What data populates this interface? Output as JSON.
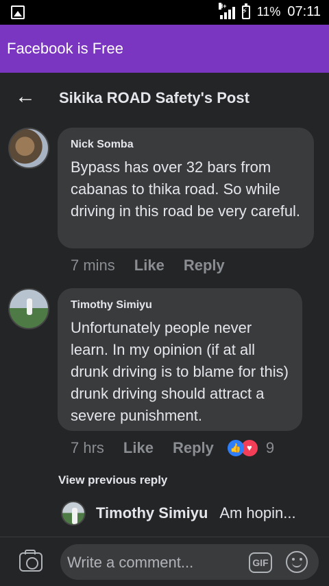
{
  "status_bar": {
    "network_label": "H+",
    "battery_percent": "11%",
    "time": "07:11",
    "icons": [
      "image-icon",
      "signal-icon",
      "battery-icon"
    ]
  },
  "app_header": {
    "title": "Facebook is Free",
    "background_color": "#7a35c1"
  },
  "post_header": {
    "back_icon": "arrow-left-icon",
    "title": "Sikika ROAD Safety's Post"
  },
  "comments": [
    {
      "author": "Nick Somba",
      "text": "Bypass has over 32 bars from cabanas to thika road. So while driving in this road be very careful.",
      "time": "7 mins",
      "actions": [
        "Like",
        "Reply"
      ]
    },
    {
      "author": "Timothy Simiyu",
      "text": "Unfortunately people never learn.  In my opinion (if at all drunk driving is to blame for this)  drunk driving should attract a severe punishment.",
      "time": "7 hrs",
      "actions": [
        "Like",
        "Reply"
      ],
      "reactions": {
        "icons": [
          "like-reaction-icon",
          "love-reaction-icon"
        ],
        "count": "9"
      }
    }
  ],
  "view_previous_reply": "View previous reply",
  "reply_preview": {
    "author": "Timothy Simiyu",
    "text": "Am hopin..."
  },
  "composer": {
    "placeholder": "Write a comment...",
    "camera_icon": "camera-icon",
    "gif_label": "GIF",
    "emoji_icon": "emoji-icon"
  }
}
